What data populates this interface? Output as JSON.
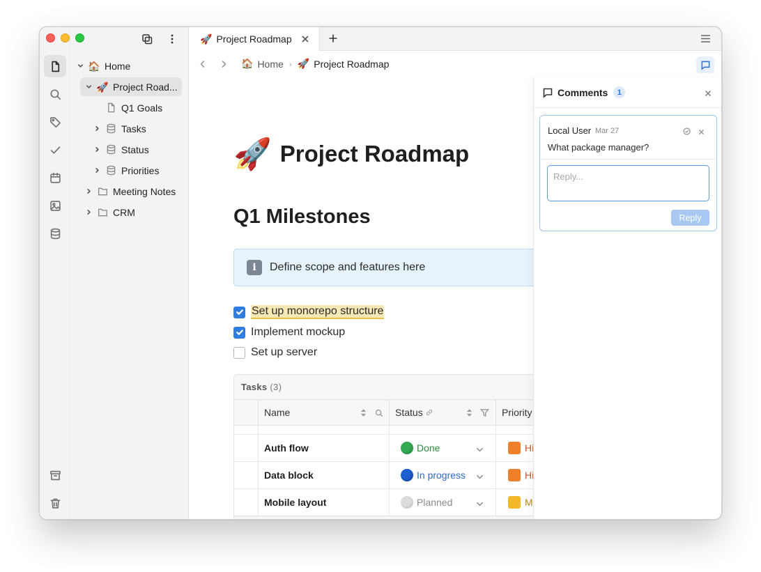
{
  "window": {
    "tab_title": "Project Roadmap",
    "tab_emoji": "🚀"
  },
  "tree": {
    "items": [
      {
        "label": "Home",
        "emoji": "🏠"
      },
      {
        "label": "Project Road...",
        "emoji": "🚀"
      },
      {
        "label": "Q1 Goals"
      },
      {
        "label": "Tasks"
      },
      {
        "label": "Status"
      },
      {
        "label": "Priorities"
      },
      {
        "label": "Meeting Notes"
      },
      {
        "label": "CRM"
      }
    ]
  },
  "breadcrumb": {
    "home_emoji": "🏠",
    "home_label": "Home",
    "separator": "›",
    "current_emoji": "🚀",
    "current_label": "Project Roadmap"
  },
  "page": {
    "title_emoji": "🚀",
    "title": "Project Roadmap",
    "heading": "Q1 Milestones",
    "callout_icon": "i",
    "callout_text": "Define scope and features here",
    "todos": [
      {
        "label": "Set up monorepo structure",
        "checked": true
      },
      {
        "label": "Implement mockup",
        "checked": true
      },
      {
        "label": "Set up server",
        "checked": false
      }
    ]
  },
  "table": {
    "title": "Tasks",
    "count": "(3)",
    "columns": [
      "Name",
      "Status",
      "Priority"
    ],
    "rows": [
      {
        "name": "Auth flow",
        "status": "Done",
        "status_color": "#34a853",
        "status_text_color": "#2e8b3a",
        "priority": "Hi",
        "priority_color": "#f07f2c",
        "priority_text_color": "#d0542a"
      },
      {
        "name": "Data block",
        "status": "In progress",
        "status_color": "#1d5fd0",
        "status_text_color": "#2a6ad4",
        "priority": "Hi",
        "priority_color": "#f07f2c",
        "priority_text_color": "#d0542a"
      },
      {
        "name": "Mobile layout",
        "status": "Planned",
        "status_color": "#dcdcdc",
        "status_text_color": "#8a8a8a",
        "priority": "M",
        "priority_color": "#f2b92b",
        "priority_text_color": "#c28a12"
      }
    ]
  },
  "comments": {
    "title": "Comments",
    "count": "1",
    "thread": {
      "author": "Local User",
      "date": "Mar 27",
      "text": "What package manager?",
      "reply_placeholder": "Reply...",
      "reply_button": "Reply"
    }
  },
  "colors": {
    "accent": "#2f7de1",
    "highlight": "#f5e8b4",
    "callout_bg": "#e6f2fc"
  }
}
